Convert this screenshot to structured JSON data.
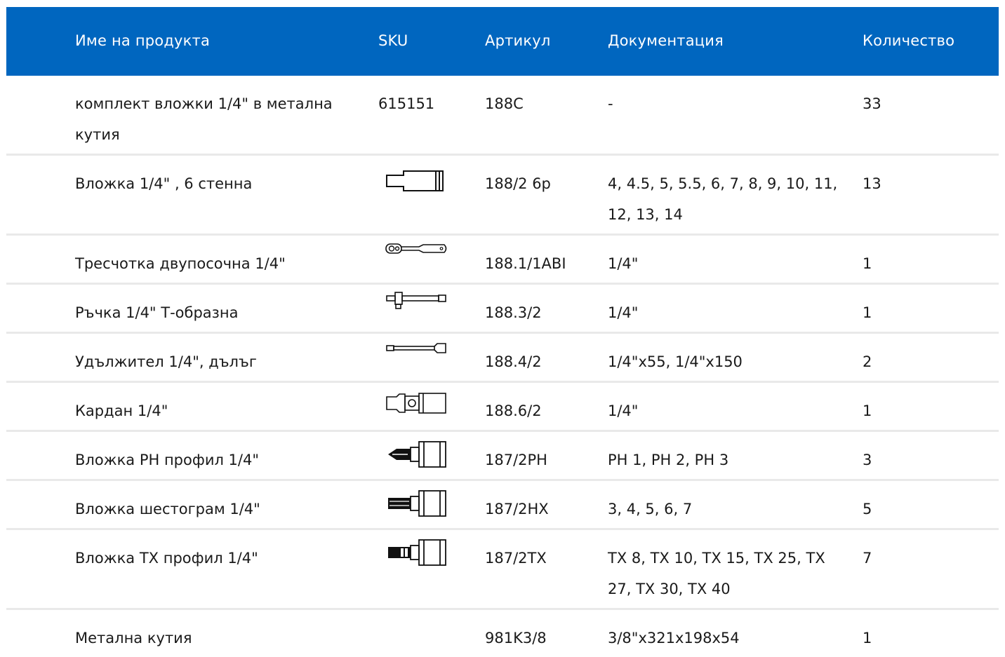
{
  "header": {
    "name": "Име на продукта",
    "sku": "SKU",
    "article": "Артикул",
    "documentation": "Документация",
    "quantity": "Количество"
  },
  "rows": [
    {
      "name": "комплект вложки 1/4\" в метална кутия",
      "sku": "615151",
      "article": "188C",
      "documentation": "-",
      "quantity": "33"
    },
    {
      "name": "Вложка 1/4\" , 6 стенна",
      "sku_icon": "hex-socket-icon",
      "article": "188/2 6p",
      "documentation": "4, 4.5, 5, 5.5, 6, 7, 8, 9, 10, 11, 12, 13, 14",
      "quantity": "13"
    },
    {
      "name": "Тресчотка двупосочна 1/4\"",
      "sku_icon": "ratchet-icon",
      "article": "188.1/1ABI",
      "documentation": "1/4\"",
      "quantity": "1"
    },
    {
      "name": "Ръчка 1/4\" Т-образна",
      "sku_icon": "t-handle-icon",
      "article": "188.3/2",
      "documentation": "1/4\"",
      "quantity": "1"
    },
    {
      "name": "Удължител 1/4\", дълъг",
      "sku_icon": "extension-bar-icon",
      "article": "188.4/2",
      "documentation": "1/4\"x55, 1/4\"x150",
      "quantity": "2"
    },
    {
      "name": "Кардан 1/4\"",
      "sku_icon": "universal-joint-icon",
      "article": "188.6/2",
      "documentation": "1/4\"",
      "quantity": "1"
    },
    {
      "name": "Вложка PH профил 1/4\"",
      "sku_icon": "ph-bit-socket-icon",
      "article": "187/2PH",
      "documentation": "PH 1, PH 2, PH 3",
      "quantity": "3"
    },
    {
      "name": "Вложка шестограм 1/4\"",
      "sku_icon": "hex-bit-socket-icon",
      "article": "187/2HX",
      "documentation": "3, 4, 5, 6, 7",
      "quantity": "5"
    },
    {
      "name": "Вложка TX профил 1/4\"",
      "sku_icon": "tx-bit-socket-icon",
      "article": "187/2TX",
      "documentation": "TX 8, TX 10, TX 15, TX 25, TX 27, TX 30, TX 40",
      "quantity": "7"
    },
    {
      "name": "Метална кутия",
      "article": "981K3/8",
      "documentation": "3/8\"x321x198x54",
      "quantity": "1"
    }
  ],
  "colors": {
    "header_bg": "#0066bf",
    "header_text": "#ffffff",
    "row_border": "#e9e9e9"
  }
}
